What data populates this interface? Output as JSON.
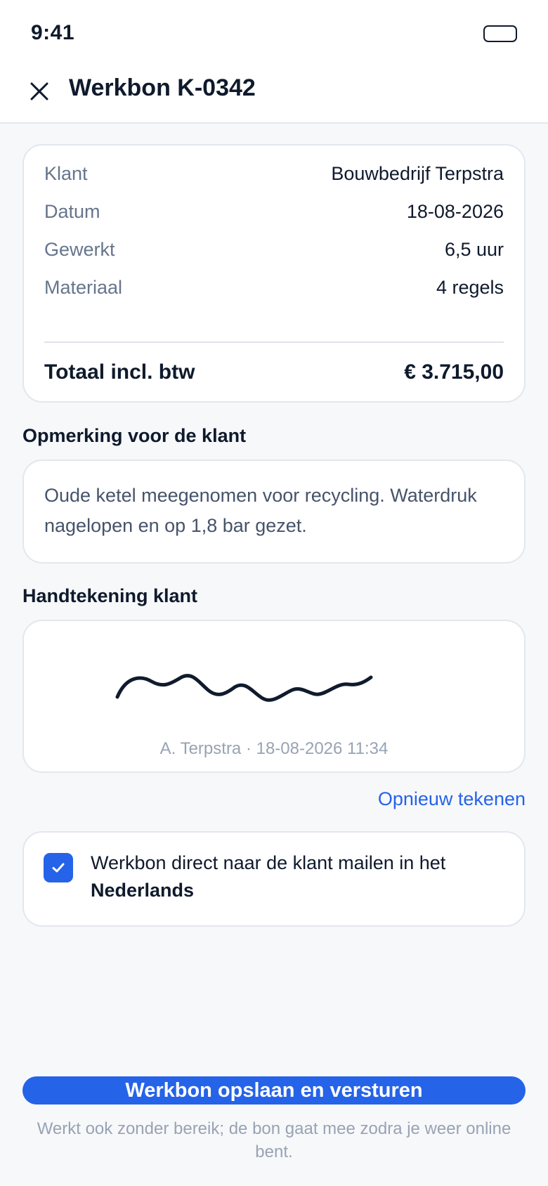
{
  "status_bar": {
    "time": "9:41"
  },
  "header": {
    "title": "Werkbon K-0342"
  },
  "summary": {
    "rows": [
      {
        "label": "Klant",
        "value": "Bouwbedrijf Terpstra"
      },
      {
        "label": "Datum",
        "value": "18-08-2026"
      },
      {
        "label": "Gewerkt",
        "value": "6,5 uur"
      },
      {
        "label": "Materiaal",
        "value": "4 regels"
      }
    ],
    "total_label": "Totaal incl. btw",
    "total_value": "€ 3.715,00"
  },
  "remark": {
    "label": "Opmerking voor de klant",
    "text": "Oude ketel meegenomen voor recycling. Waterdruk nagelopen en op 1,8 bar gezet."
  },
  "signature": {
    "label": "Handtekening klant",
    "caption": "A. Terpstra · 18-08-2026 11:34",
    "redraw_label": "Opnieuw tekenen"
  },
  "email_option": {
    "checked": true,
    "text": "Werkbon direct naar de klant mailen in het",
    "language": "Nederlands"
  },
  "primary_action": {
    "label": "Werkbon opslaan en versturen"
  },
  "footer_note": "Werkt ook zonder bereik; de bon gaat mee zodra je weer online bent.",
  "colors": {
    "accent": "#2563e8",
    "text": "#0f1a2c",
    "muted": "#66758c"
  }
}
